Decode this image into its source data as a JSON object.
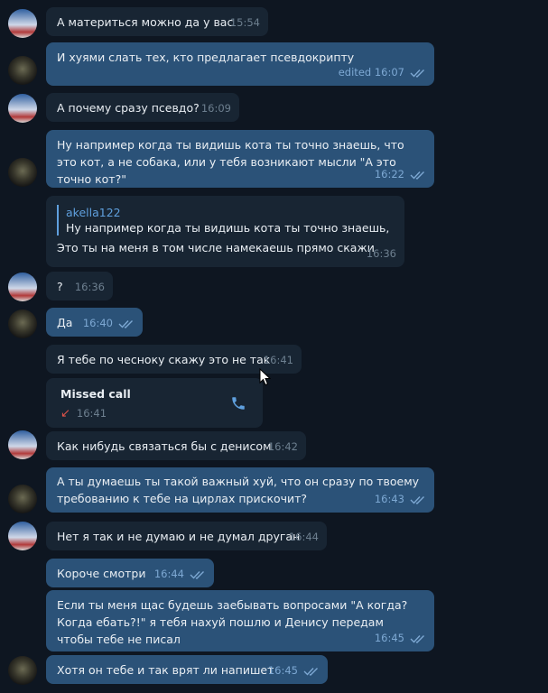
{
  "messages": [
    {
      "text": "А материться можно да у вас",
      "time": "15:54"
    },
    {
      "text": "И хуями слать тех, кто предлагает псевдокрипту",
      "time": "edited 16:07"
    },
    {
      "text": "А почему сразу псевдо?",
      "time": "16:09"
    },
    {
      "text": "Ну например когда ты видишь кота ты точно знаешь, что это кот, а не собака, или у тебя возникают мысли \"А это точно кот?\"",
      "time": "16:22"
    },
    {
      "reply_author": "akella122",
      "reply_text": "Ну например когда ты видишь кота ты точно знаешь, ч...",
      "text": "Это ты на меня в том числе намекаешь прямо скажи",
      "time": "16:36"
    },
    {
      "text": "?",
      "time": "16:36"
    },
    {
      "text": "Да",
      "time": "16:40"
    },
    {
      "text": "Я тебе по чесноку скажу это не так",
      "time": "16:41"
    },
    {
      "call_title": "Missed call",
      "time": "16:41"
    },
    {
      "text": "Как нибудь связаться бы с денисом",
      "time": "16:42"
    },
    {
      "text": "А ты думаешь ты такой важный хуй, что он сразу по твоему требованию к тебе на цирлах прискочит?",
      "time": "16:43"
    },
    {
      "text": "Нет я так и не думаю и не думал друган",
      "time": "16:44"
    },
    {
      "text": "Короче смотри",
      "time": "16:44"
    },
    {
      "text": "Если ты меня щас будешь заебывать вопросами \"А когда? Когда ебать?!\"  я тебя нахуй пошлю и Денису передам чтобы тебе не писал",
      "time": "16:45"
    },
    {
      "text": "Хотя он тебе и так врят ли напишет",
      "time": "16:45"
    }
  ],
  "colors": {
    "incoming": "#182533",
    "outgoing": "#2b5278",
    "background": "#0e1621",
    "accent": "#5fa0de",
    "missed": "#e0534a"
  }
}
